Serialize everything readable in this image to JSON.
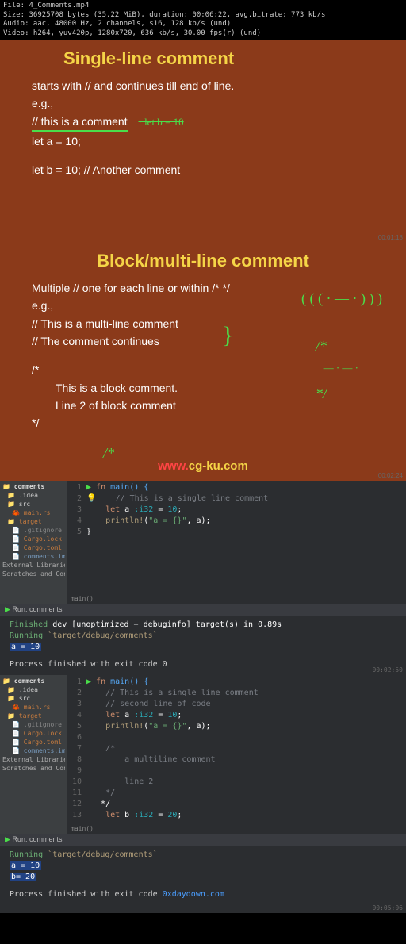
{
  "meta": {
    "file": "File: 4_Comments.mp4",
    "size": "Size: 36925708 bytes (35.22 MiB), duration: 00:06:22, avg.bitrate: 773 kb/s",
    "audio": "Audio: aac, 48000 Hz, 2 channels, s16, 128 kb/s (und)",
    "video": "Video: h264, yuv420p, 1280x720, 636 kb/s, 30.00 fps(r) (und)"
  },
  "slide1": {
    "title": "Single-line comment",
    "line1": "starts with // and continues till end of line.",
    "line2": "e.g.,",
    "line3": "// this is a comment",
    "scribble": "· let b = 10",
    "line4": "let a = 10;",
    "line5": "let b = 10; // Another comment",
    "timestamp": "00:01:18"
  },
  "slide2": {
    "title": "Block/multi-line comment",
    "line1": "Multiple // one for each line or within /*  */",
    "line2": "e.g.,",
    "line3": "// This is a multi-line comment",
    "line4": "// The comment continues",
    "line5": "/*",
    "line6": "This is a block comment.",
    "line7": "Line 2 of block comment",
    "line8": "*/",
    "scribble_bracket": "}",
    "scribble_top": "( ( ( · — · ) ) )",
    "scribble_star1": "/*",
    "scribble_dash": "— · — ·",
    "scribble_star2": "*/",
    "scribble_bottom": "/*",
    "timestamp": "00:02:24"
  },
  "watermark1": {
    "red": "www.",
    "yellow": "cg-ku.com"
  },
  "ide1": {
    "sidebar": {
      "project": "comments",
      "idea": ".idea",
      "src": "src",
      "main": "main.rs",
      "target": "target",
      "gitignore": ".gitignore",
      "cargolock": "Cargo.lock",
      "cargotoml": "Cargo.toml",
      "iml": "comments.iml",
      "external": "External Libraries",
      "scratches": "Scratches and Con"
    },
    "code": {
      "l1_fn": "fn",
      "l1_main": " main() {",
      "l2": "    // This is a single line comment",
      "l3_let": "    let",
      "l3_a": " a",
      "l3_type": " :i32",
      "l3_eq": " = ",
      "l3_num": "10",
      "l3_semi": ";",
      "l4_print": "    println!",
      "l4_paren": "(",
      "l4_str": "\"a = {}\"",
      "l4_rest": ", a);",
      "l5": "}"
    },
    "breadcrumb": "main()"
  },
  "run1": {
    "header": "Run: comments",
    "finished_kw": "Finished",
    "finished_rest": " dev [unoptimized + debuginfo] target(s) in 0.89s",
    "running_kw": "Running",
    "running_rest": " `target/debug/comments`",
    "output": "a = 10",
    "exit": "Process finished with exit code 0",
    "timestamp": "00:02:50"
  },
  "ide2": {
    "code": {
      "l1_fn": "fn",
      "l1_main": " main() {",
      "l2": "    // This is a single line comment",
      "l3": "    // second line of code",
      "l4_let": "    let",
      "l4_a": " a",
      "l4_type": " :i32",
      "l4_eq": " = ",
      "l4_num": "10",
      "l4_semi": ";",
      "l5_print": "    println!",
      "l5_paren": "(",
      "l5_str": "\"a = {}\"",
      "l5_rest": ", a);",
      "l6": "",
      "l7": "    /*",
      "l8": "        a multiline comment",
      "l9": "",
      "l10": "        line 2",
      "l11": "    */",
      "l12": "   */",
      "l13_let": "    let",
      "l13_b": " b",
      "l13_type": " :i32",
      "l13_eq": " = ",
      "l13_num": "20",
      "l13_semi": ";"
    },
    "breadcrumb": "main()"
  },
  "run2": {
    "header": "Run: comments",
    "running_kw": "Running",
    "running_rest": " `target/debug/comments`",
    "output1": "a = 10",
    "output2": "b= 20",
    "exit": "Process finished with exit code",
    "watermark": "0xdaydown.com",
    "timestamp": "00:05:06"
  }
}
